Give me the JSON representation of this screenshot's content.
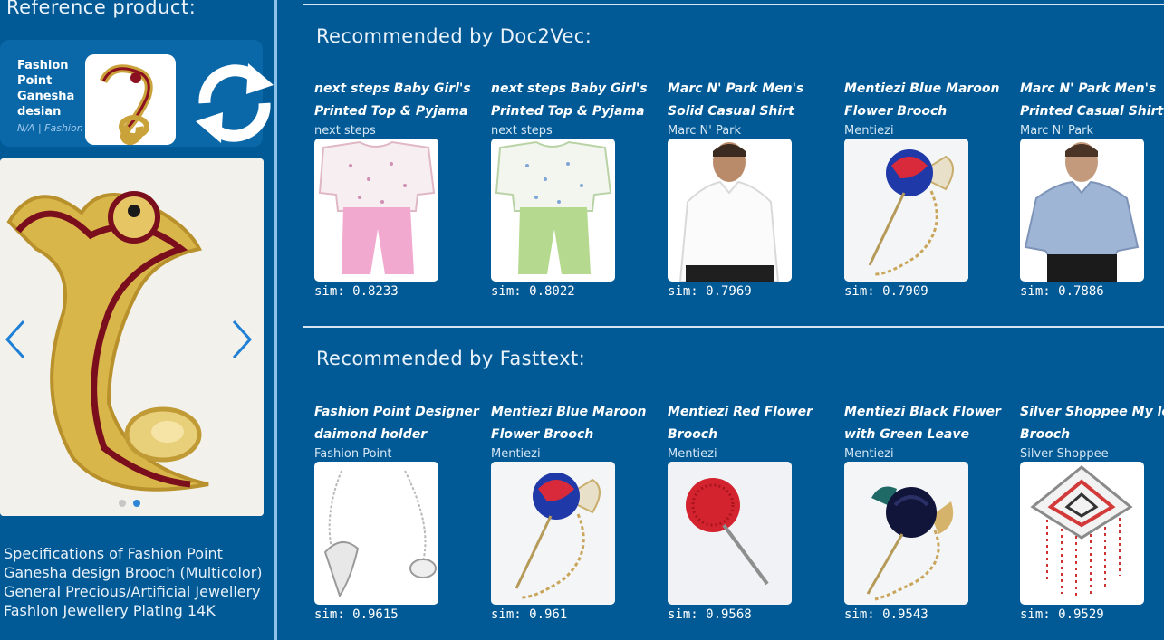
{
  "reference": {
    "title": "Reference product:",
    "name": "Fashion Point Ganesha desian",
    "meta": "N/A | Fashion",
    "specs": "Specifications of Fashion Point Ganesha design Brooch (Multicolor) General Precious/Artificial Jewellery Fashion Jewellery Plating 14K"
  },
  "sections": [
    {
      "title": "Recommended by Doc2Vec:",
      "items": [
        {
          "name_l1": "next steps Baby Girl's",
          "name_l2": "Printed Top & Pyjama",
          "brand": "next steps",
          "sim": "sim: 0.8233",
          "image": "pink-pyjama-set"
        },
        {
          "name_l1": "next steps Baby Girl's",
          "name_l2": "Printed Top & Pyjama",
          "brand": "next steps",
          "sim": "sim: 0.8022",
          "image": "green-pyjama-set"
        },
        {
          "name_l1": "Marc N' Park Men's",
          "name_l2": "Solid Casual Shirt",
          "brand": "Marc N' Park",
          "sim": "sim: 0.7969",
          "image": "white-shirt"
        },
        {
          "name_l1": "Mentiezi Blue Maroon",
          "name_l2": "Flower Brooch",
          "brand": "Mentiezi",
          "sim": "sim: 0.7909",
          "image": "blue-maroon-brooch"
        },
        {
          "name_l1": "Marc N' Park Men's",
          "name_l2": "Printed Casual Shirt",
          "brand": "Marc N' Park",
          "sim": "sim: 0.7886",
          "image": "blue-shirt"
        }
      ]
    },
    {
      "title": "Recommended by Fasttext:",
      "items": [
        {
          "name_l1": "Fashion Point Designer",
          "name_l2": "daimond holder",
          "brand": "Fashion Point",
          "sim": "sim: 0.9615",
          "image": "diamond-necklace"
        },
        {
          "name_l1": "Mentiezi Blue Maroon",
          "name_l2": "Flower Brooch",
          "brand": "Mentiezi",
          "sim": "sim: 0.961",
          "image": "blue-maroon-brooch"
        },
        {
          "name_l1": "Mentiezi Red Flower",
          "name_l2": "Brooch",
          "brand": "Mentiezi",
          "sim": "sim: 0.9568",
          "image": "red-flower-brooch"
        },
        {
          "name_l1": "Mentiezi Black Flower",
          "name_l2": "with Green Leave",
          "brand": "Mentiezi",
          "sim": "sim: 0.9543",
          "image": "black-flower-brooch"
        },
        {
          "name_l1": "Silver Shoppee My love",
          "name_l2": "Brooch",
          "brand": "Silver Shoppee",
          "sim": "sim: 0.9529",
          "image": "silver-brooch"
        }
      ]
    }
  ],
  "colors": {
    "background": "#015a96",
    "card": "#0a67a8",
    "accent": "#2f86d9"
  },
  "icons": {
    "refresh": "refresh-icon",
    "prev": "chevron-left-icon",
    "next": "chevron-right-icon"
  }
}
